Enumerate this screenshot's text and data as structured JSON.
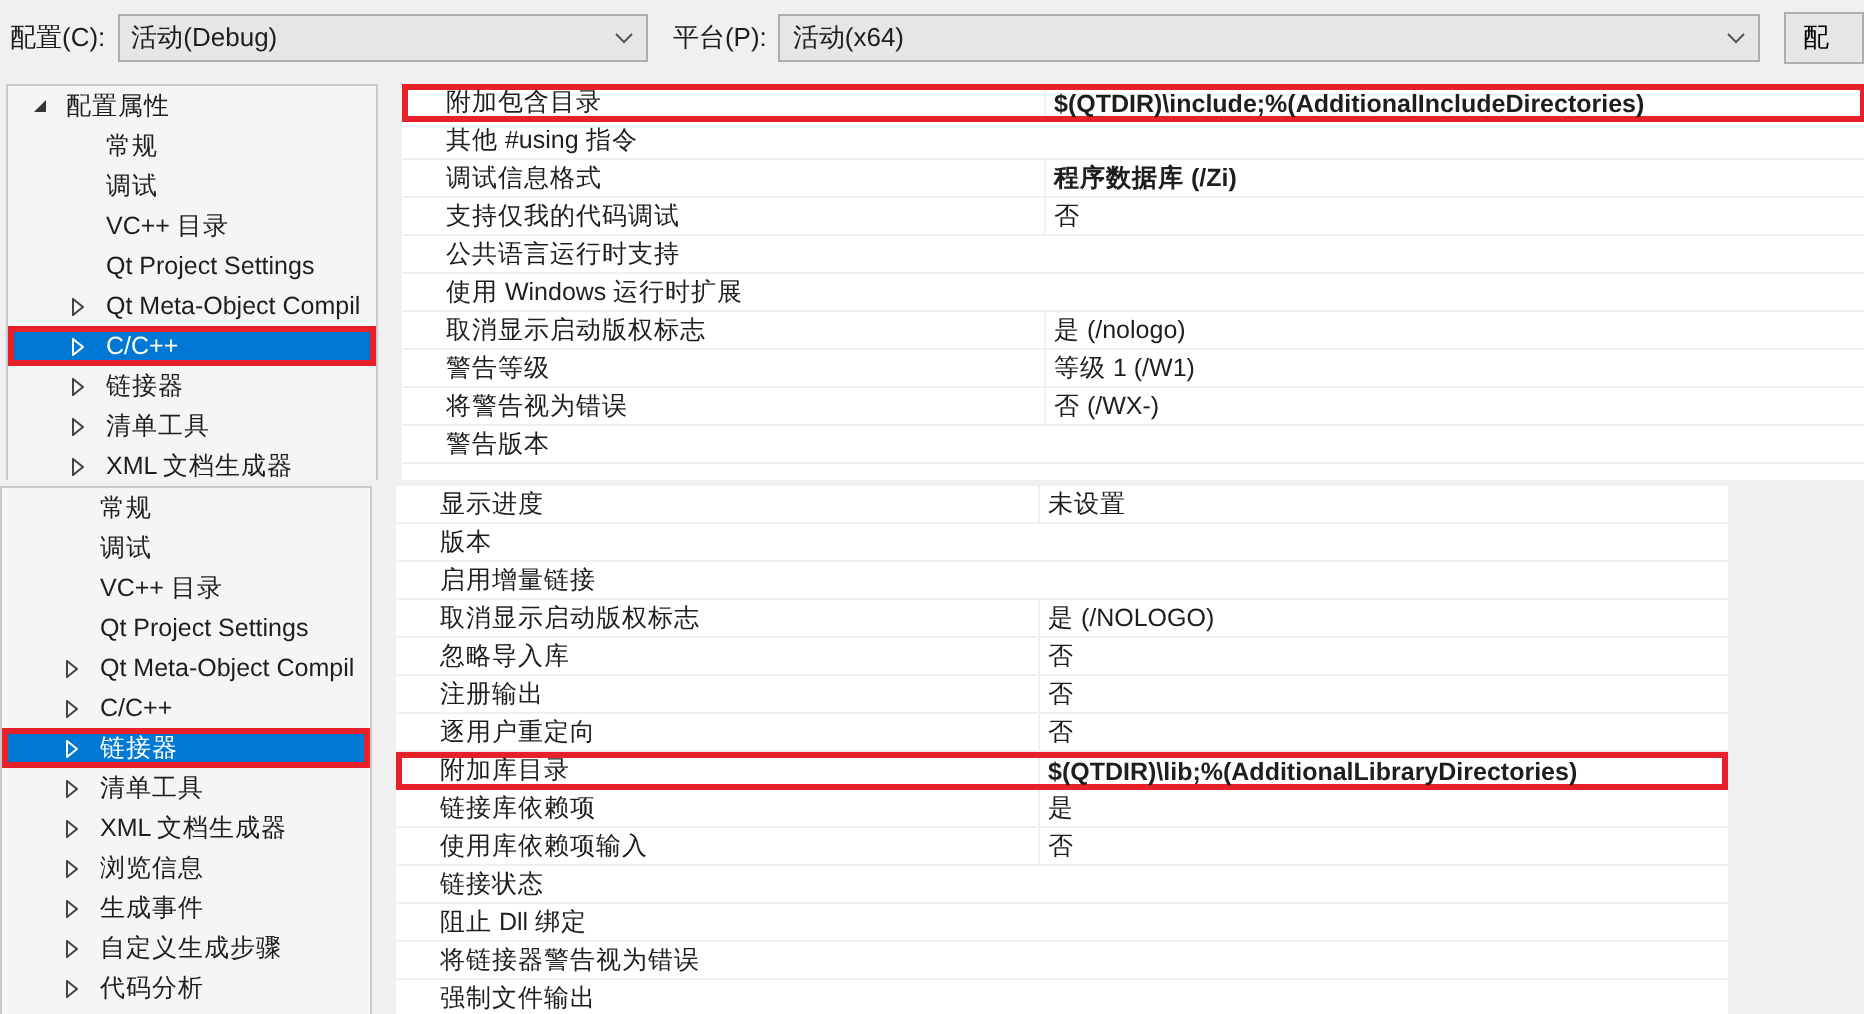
{
  "toolbar": {
    "config_label": "配置(C):",
    "config_value": "活动(Debug)",
    "platform_label": "平台(P):",
    "platform_value": "活动(x64)",
    "button": "配"
  },
  "panels": [
    {
      "tree": [
        {
          "label": "配置属性",
          "expandable": true,
          "expanded": true,
          "selected": false,
          "highlighted": false,
          "children": [
            {
              "label": "常规",
              "expandable": false,
              "selected": false,
              "highlighted": false
            },
            {
              "label": "调试",
              "expandable": false,
              "selected": false,
              "highlighted": false
            },
            {
              "label": "VC++ 目录",
              "expandable": false,
              "selected": false,
              "highlighted": false
            },
            {
              "label": "Qt Project Settings",
              "expandable": false,
              "selected": false,
              "highlighted": false
            },
            {
              "label": "Qt Meta-Object Compil",
              "expandable": true,
              "expanded": false,
              "selected": false,
              "highlighted": false
            },
            {
              "label": "C/C++",
              "expandable": true,
              "expanded": false,
              "selected": true,
              "highlighted": true
            },
            {
              "label": "链接器",
              "expandable": true,
              "expanded": false,
              "selected": false,
              "highlighted": false
            },
            {
              "label": "清单工具",
              "expandable": true,
              "expanded": false,
              "selected": false,
              "highlighted": false
            },
            {
              "label": "XML 文档生成器",
              "expandable": true,
              "expanded": false,
              "selected": false,
              "highlighted": false
            }
          ]
        }
      ],
      "rows": [
        {
          "name": "附加包含目录",
          "value": "$(QTDIR)\\include;%(AdditionalIncludeDirectories)",
          "bold": true,
          "highlighted": true
        },
        {
          "name": "其他 #using 指令",
          "highlighted": false
        },
        {
          "name": "调试信息格式",
          "value": "程序数据库 (/Zi)",
          "bold": true,
          "highlighted": false
        },
        {
          "name": "支持仅我的代码调试",
          "value": "否",
          "bold": false,
          "highlighted": false
        },
        {
          "name": "公共语言运行时支持",
          "highlighted": false
        },
        {
          "name": "使用 Windows 运行时扩展",
          "highlighted": false
        },
        {
          "name": "取消显示启动版权标志",
          "value": "是 (/nologo)",
          "bold": false,
          "highlighted": false
        },
        {
          "name": "警告等级",
          "value": "等级 1 (/W1)",
          "bold": false,
          "highlighted": false
        },
        {
          "name": "将警告视为错误",
          "value": "否 (/WX-)",
          "bold": false,
          "highlighted": false
        },
        {
          "name": "警告版本",
          "highlighted": false
        }
      ]
    },
    {
      "tree": [
        {
          "label": "常规",
          "expandable": false,
          "selected": false,
          "highlighted": false
        },
        {
          "label": "调试",
          "expandable": false,
          "selected": false,
          "highlighted": false
        },
        {
          "label": "VC++ 目录",
          "expandable": false,
          "selected": false,
          "highlighted": false
        },
        {
          "label": "Qt Project Settings",
          "expandable": false,
          "selected": false,
          "highlighted": false
        },
        {
          "label": "Qt Meta-Object Compil",
          "expandable": true,
          "expanded": false,
          "selected": false,
          "highlighted": false
        },
        {
          "label": "C/C++",
          "expandable": true,
          "expanded": false,
          "selected": false,
          "highlighted": false
        },
        {
          "label": "链接器",
          "expandable": true,
          "expanded": false,
          "selected": true,
          "highlighted": true
        },
        {
          "label": "清单工具",
          "expandable": true,
          "expanded": false,
          "selected": false,
          "highlighted": false
        },
        {
          "label": "XML 文档生成器",
          "expandable": true,
          "expanded": false,
          "selected": false,
          "highlighted": false
        },
        {
          "label": "浏览信息",
          "expandable": true,
          "expanded": false,
          "selected": false,
          "highlighted": false
        },
        {
          "label": "生成事件",
          "expandable": true,
          "expanded": false,
          "selected": false,
          "highlighted": false
        },
        {
          "label": "自定义生成步骤",
          "expandable": true,
          "expanded": false,
          "selected": false,
          "highlighted": false
        },
        {
          "label": "代码分析",
          "expandable": true,
          "expanded": false,
          "selected": false,
          "highlighted": false
        }
      ],
      "rows": [
        {
          "name": "显示进度",
          "value": "未设置",
          "bold": false,
          "highlighted": false
        },
        {
          "name": "版本",
          "highlighted": false
        },
        {
          "name": "启用增量链接",
          "highlighted": false
        },
        {
          "name": "取消显示启动版权标志",
          "value": "是 (/NOLOGO)",
          "bold": false,
          "highlighted": false
        },
        {
          "name": "忽略导入库",
          "value": "否",
          "bold": false,
          "highlighted": false
        },
        {
          "name": "注册输出",
          "value": "否",
          "bold": false,
          "highlighted": false
        },
        {
          "name": "逐用户重定向",
          "value": "否",
          "bold": false,
          "highlighted": false
        },
        {
          "name": "附加库目录",
          "value": "$(QTDIR)\\lib;%(AdditionalLibraryDirectories)",
          "bold": true,
          "highlighted": true
        },
        {
          "name": "链接库依赖项",
          "value": "是",
          "bold": false,
          "highlighted": false
        },
        {
          "name": "使用库依赖项输入",
          "value": "否",
          "bold": false,
          "highlighted": false
        },
        {
          "name": "链接状态",
          "highlighted": false
        },
        {
          "name": "阻止 Dll 绑定",
          "highlighted": false
        },
        {
          "name": "将链接器警告视为错误",
          "highlighted": false
        },
        {
          "name": "强制文件输出",
          "highlighted": false
        }
      ]
    }
  ]
}
